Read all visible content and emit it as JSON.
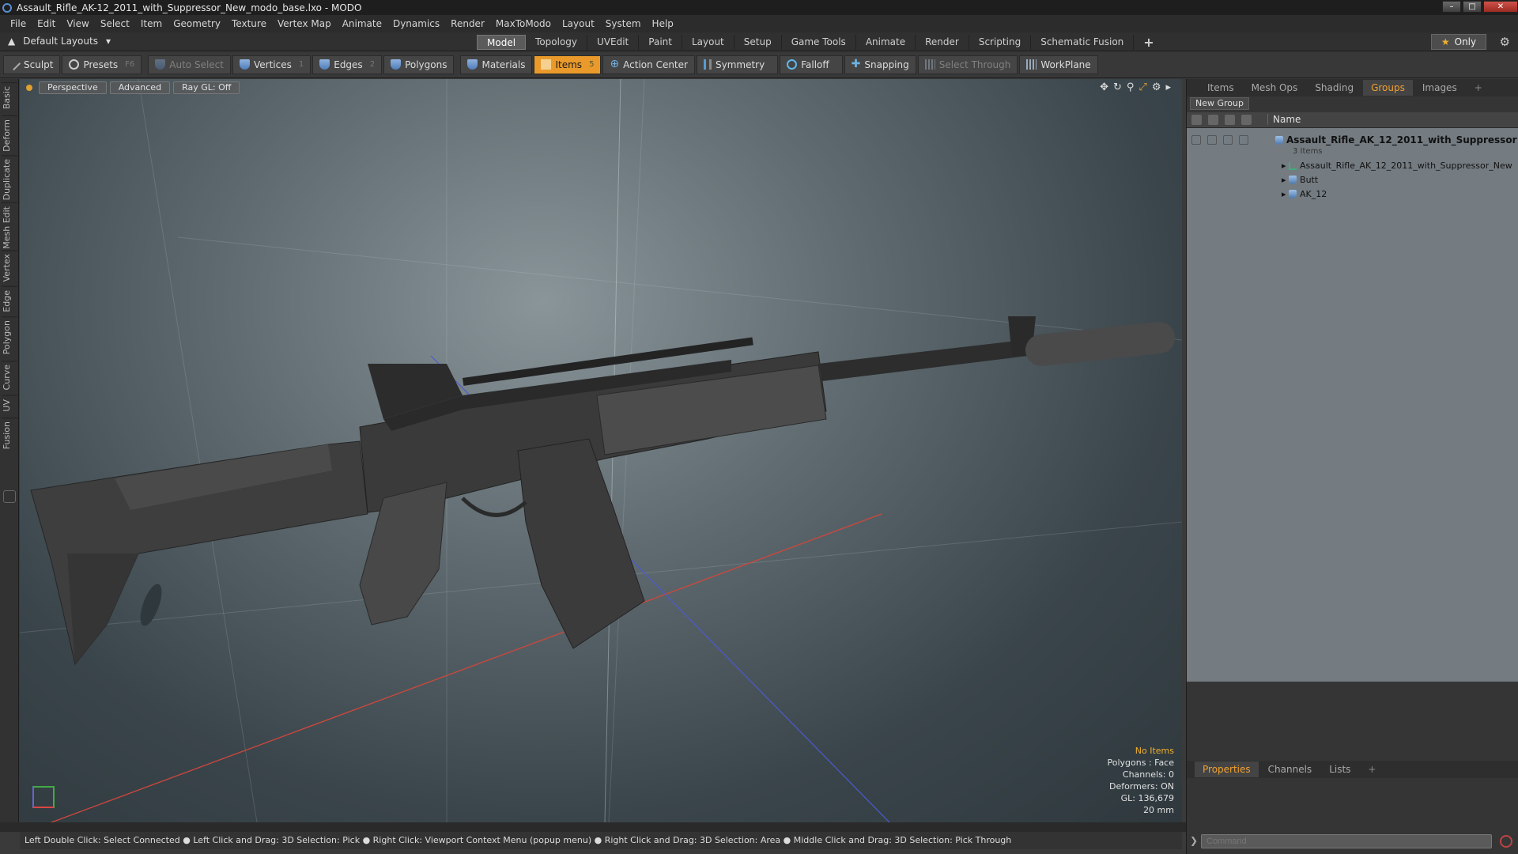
{
  "window": {
    "title": "Assault_Rifle_AK-12_2011_with_Suppressor_New_modo_base.lxo - MODO"
  },
  "menu": [
    "File",
    "Edit",
    "View",
    "Select",
    "Item",
    "Geometry",
    "Texture",
    "Vertex Map",
    "Animate",
    "Dynamics",
    "Render",
    "MaxToModo",
    "Layout",
    "System",
    "Help"
  ],
  "layout": {
    "default_layouts": "Default Layouts",
    "tabs": [
      "Model",
      "Topology",
      "UVEdit",
      "Paint",
      "Layout",
      "Setup",
      "Game Tools",
      "Animate",
      "Render",
      "Scripting",
      "Schematic Fusion"
    ],
    "active_tab": "Model",
    "only_label": "Only"
  },
  "toolbar": {
    "sculpt": "Sculpt",
    "presets": "Presets",
    "presets_key": "F6",
    "auto_select": "Auto Select",
    "vertices": "Vertices",
    "vertices_count": "1",
    "edges": "Edges",
    "edges_count": "2",
    "polygons": "Polygons",
    "materials": "Materials",
    "items": "Items",
    "items_count": "5",
    "action_center": "Action Center",
    "symmetry": "Symmetry",
    "falloff": "Falloff",
    "snapping": "Snapping",
    "select_through": "Select Through",
    "workplane": "WorkPlane"
  },
  "left_tabs": [
    "Basic",
    "Deform",
    "Duplicate",
    "Mesh Edit",
    "Vertex",
    "Edge",
    "Polygon",
    "Curve",
    "UV",
    "Fusion"
  ],
  "viewport": {
    "view": "Perspective",
    "shading": "Advanced",
    "raygl": "Ray GL: Off",
    "info": {
      "no_items": "No Items",
      "polygons": "Polygons : Face",
      "channels": "Channels: 0",
      "deformers": "Deformers: ON",
      "gl": "GL: 136,679",
      "scale": "20 mm"
    }
  },
  "status_bar": "Left Double Click: Select Connected ● Left Click and Drag: 3D Selection: Pick ● Right Click: Viewport Context Menu (popup menu) ● Right Click and Drag: 3D Selection: Area ● Middle Click and Drag: 3D Selection: Pick Through",
  "right_panel": {
    "tabs": [
      "Items",
      "Mesh Ops",
      "Shading",
      "Groups",
      "Images"
    ],
    "active_tab": "Groups",
    "new_group": "New Group",
    "name_column": "Name",
    "tree": {
      "root": "Assault_Rifle_AK_12_2011_with_Suppressor ...",
      "root_sub": "3 Items",
      "children": [
        "Assault_Rifle_AK_12_2011_with_Suppressor_New",
        "Butt",
        "AK_12"
      ]
    },
    "bottom_tabs": [
      "Properties",
      "Channels",
      "Lists"
    ],
    "bottom_active": "Properties",
    "command_placeholder": "Command"
  }
}
